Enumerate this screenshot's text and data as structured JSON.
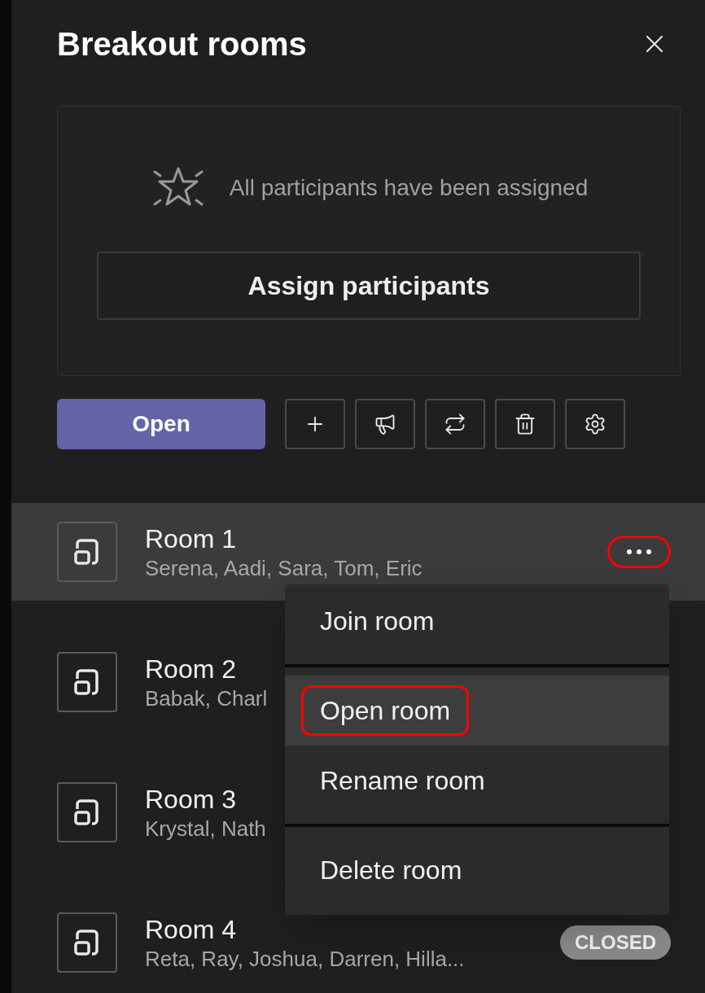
{
  "header": {
    "title": "Breakout rooms"
  },
  "status_card": {
    "message": "All participants have been assigned",
    "button": "Assign participants"
  },
  "toolbar": {
    "primary_button": "Open"
  },
  "rooms": [
    {
      "name": "Room 1",
      "participants": "Serena, Aadi, Sara, Tom, Eric",
      "selected": true,
      "more_button": {
        "annotated": true
      }
    },
    {
      "name": "Room 2",
      "participants": "Babak, Charl",
      "selected": false
    },
    {
      "name": "Room 3",
      "participants": "Krystal, Nath",
      "selected": false
    },
    {
      "name": "Room 4",
      "participants": "Reta, Ray, Joshua, Darren, Hilla...",
      "selected": false,
      "badge": "CLOSED"
    }
  ],
  "context_menu": {
    "items": [
      {
        "label": "Join room",
        "selected": false,
        "annotated": false,
        "separator_after": true
      },
      {
        "label": "Open room",
        "selected": true,
        "annotated": true,
        "separator_after": false
      },
      {
        "label": "Rename room",
        "selected": false,
        "annotated": false,
        "separator_after": true
      },
      {
        "label": "Delete room",
        "selected": false,
        "annotated": false,
        "separator_after": false
      }
    ]
  }
}
